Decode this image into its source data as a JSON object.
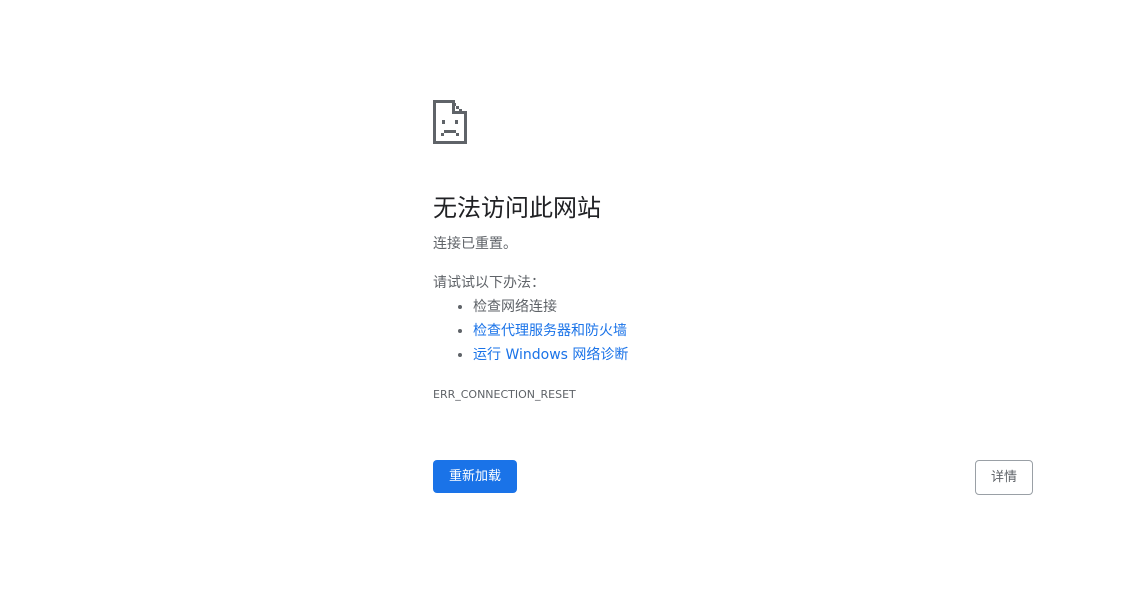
{
  "error": {
    "icon": "sad-page-icon",
    "title": "无法访问此网站",
    "subtitle": "连接已重置。",
    "suggestions_heading": "请试试以下办法：",
    "suggestions": [
      {
        "text": "检查网络连接",
        "is_link": false
      },
      {
        "text": "检查代理服务器和防火墙",
        "is_link": true
      },
      {
        "text": "运行 Windows 网络诊断",
        "is_link": true
      }
    ],
    "code": "ERR_CONNECTION_RESET"
  },
  "buttons": {
    "reload_label": "重新加载",
    "details_label": "详情"
  },
  "colors": {
    "primary": "#1a73e8",
    "text": "#202124",
    "secondary_text": "#5f6368",
    "border": "#9aa0a6"
  }
}
